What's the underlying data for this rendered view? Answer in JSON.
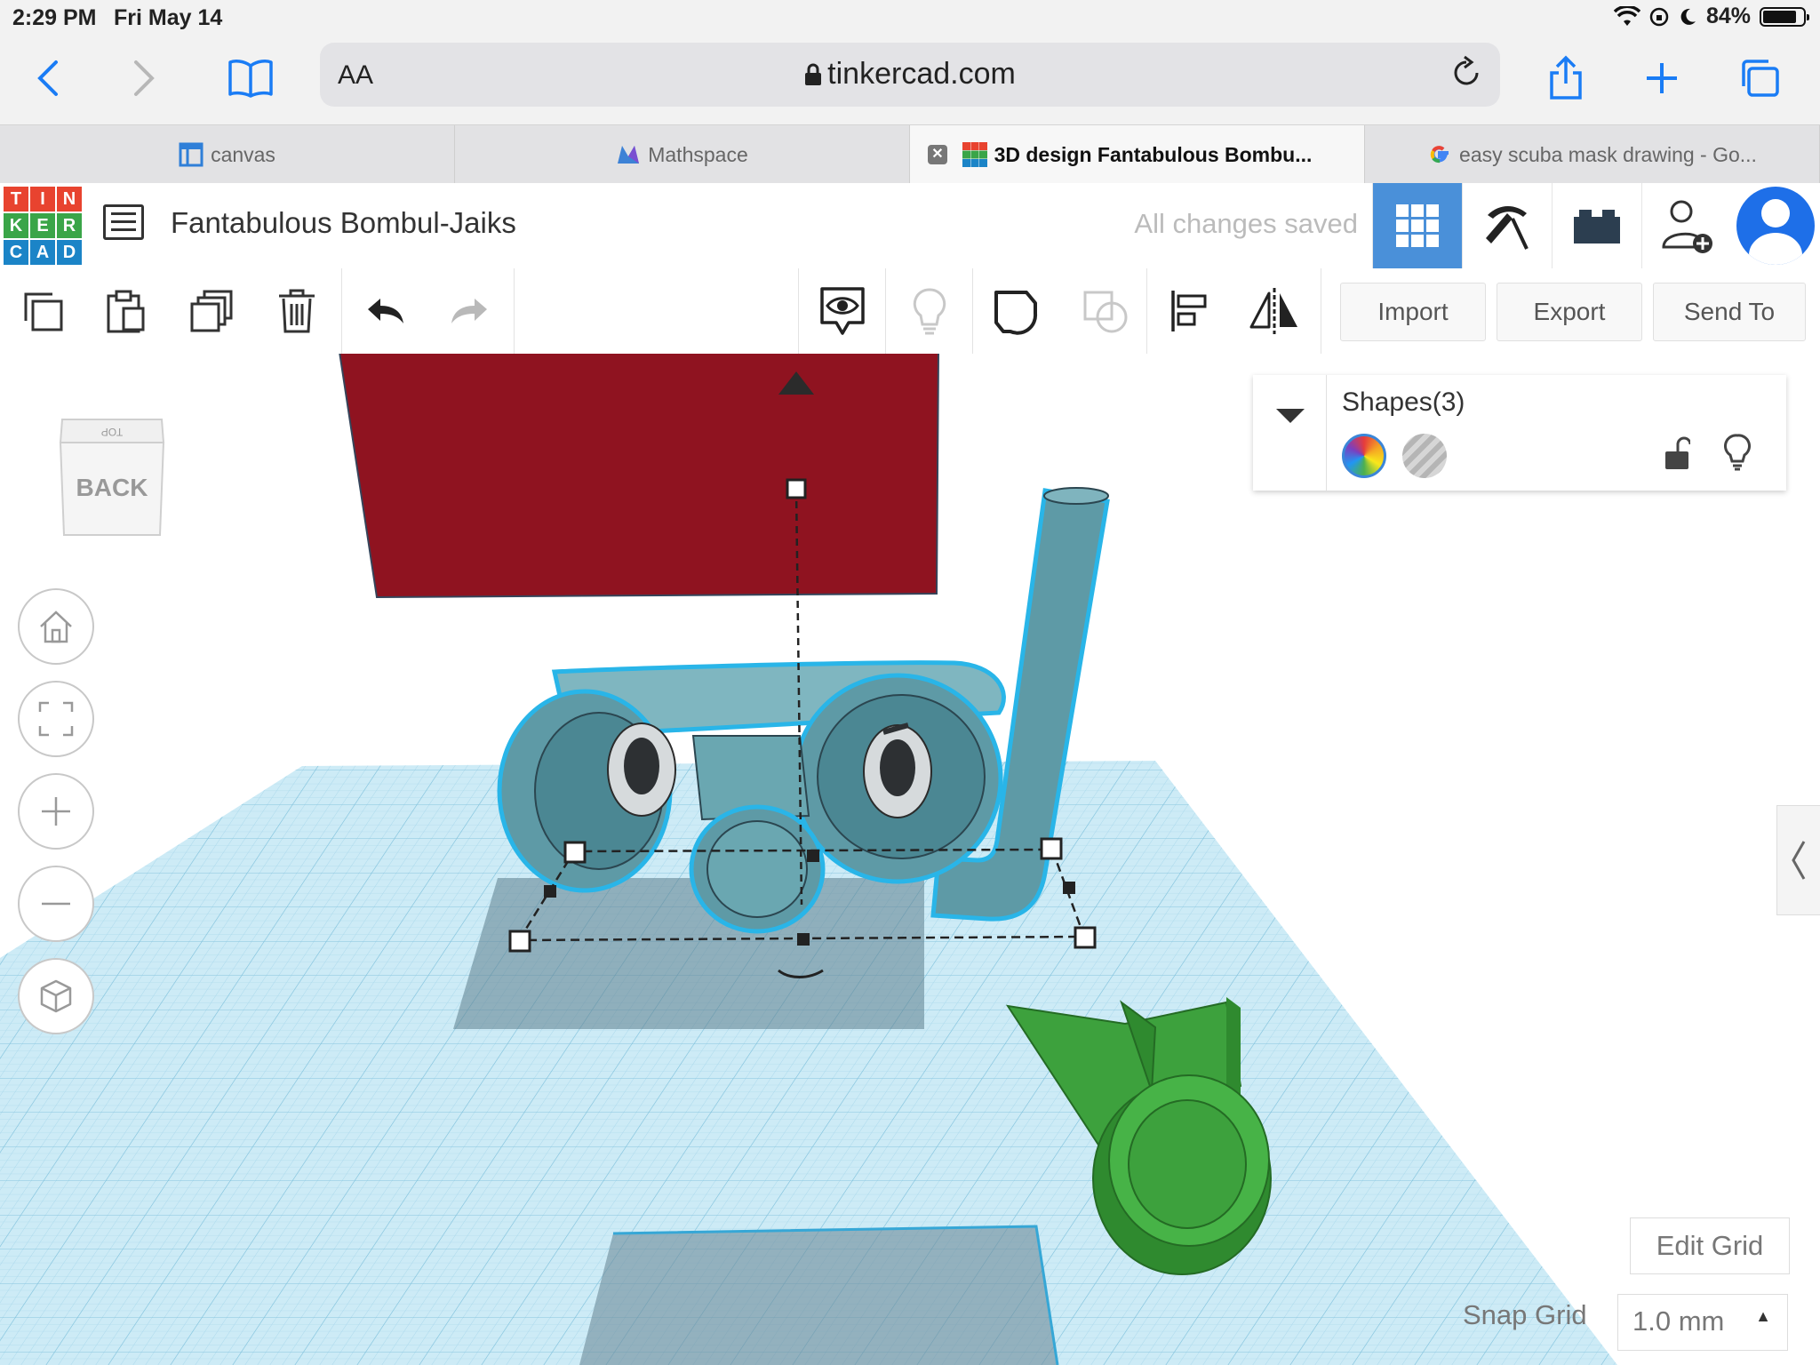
{
  "status_bar": {
    "time": "2:29 PM",
    "date": "Fri May 14",
    "battery": "84%",
    "battery_level": 0.84
  },
  "browser": {
    "aa_label": "AA",
    "url": "tinkercad.com",
    "tabs": [
      {
        "label": "canvas",
        "active": false
      },
      {
        "label": "Mathspace",
        "active": false
      },
      {
        "label": "3D design Fantabulous Bombu...",
        "active": true
      },
      {
        "label": "easy scuba mask drawing - Go...",
        "active": false
      }
    ]
  },
  "tinkercad": {
    "logo_letters": [
      "T",
      "I",
      "N",
      "K",
      "E",
      "R",
      "C",
      "A",
      "D"
    ],
    "logo_colors": [
      "#e8432f",
      "#e8432f",
      "#e8432f",
      "#3aa548",
      "#3aa548",
      "#3aa548",
      "#1b84c7",
      "#1b84c7",
      "#1b84c7"
    ],
    "design_title": "Fantabulous Bombul-Jaiks",
    "save_status": "All changes saved",
    "toolbar_buttons": {
      "import": "Import",
      "export": "Export",
      "send_to": "Send To"
    }
  },
  "viewcube": {
    "front_face": "BACK",
    "top_face": "TOP"
  },
  "shapes_panel": {
    "title": "Shapes(3)"
  },
  "grid_controls": {
    "edit_grid": "Edit Grid",
    "snap_label": "Snap Grid",
    "snap_value": "1.0 mm"
  },
  "colors": {
    "accent": "#1a7cf5",
    "selected_tool": "#4a90d9",
    "mask": "#5e9aa6",
    "red_box": "#8f1320",
    "fin": "#3da13d",
    "grid": "#bfe3f2"
  }
}
